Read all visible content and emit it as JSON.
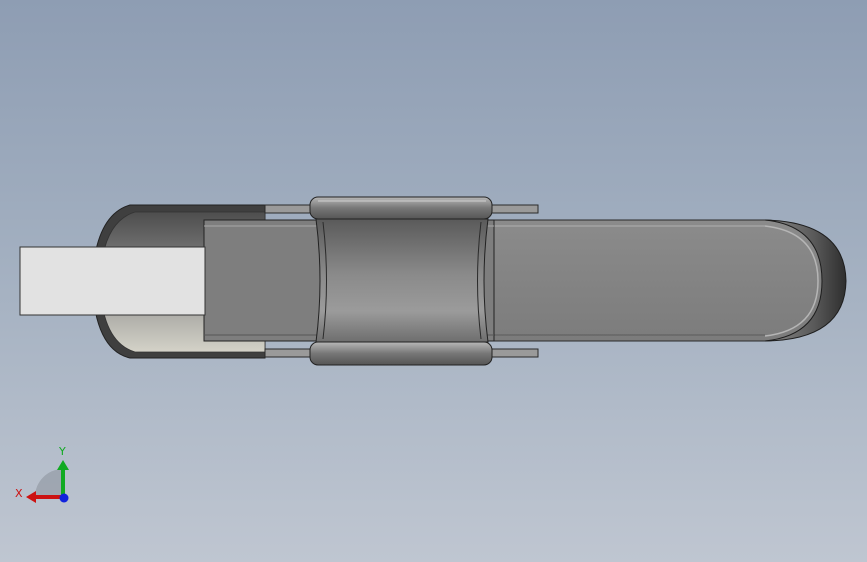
{
  "viewport": {
    "background_top": "#8e9db3",
    "background_bottom": "#bfc6d1"
  },
  "triad": {
    "x_label": "X",
    "y_label": "Y",
    "x_color": "#cc1111",
    "y_color": "#11aa22",
    "z_color": "#1122dd"
  },
  "model": {
    "icon": "chain-link-3d-model"
  }
}
